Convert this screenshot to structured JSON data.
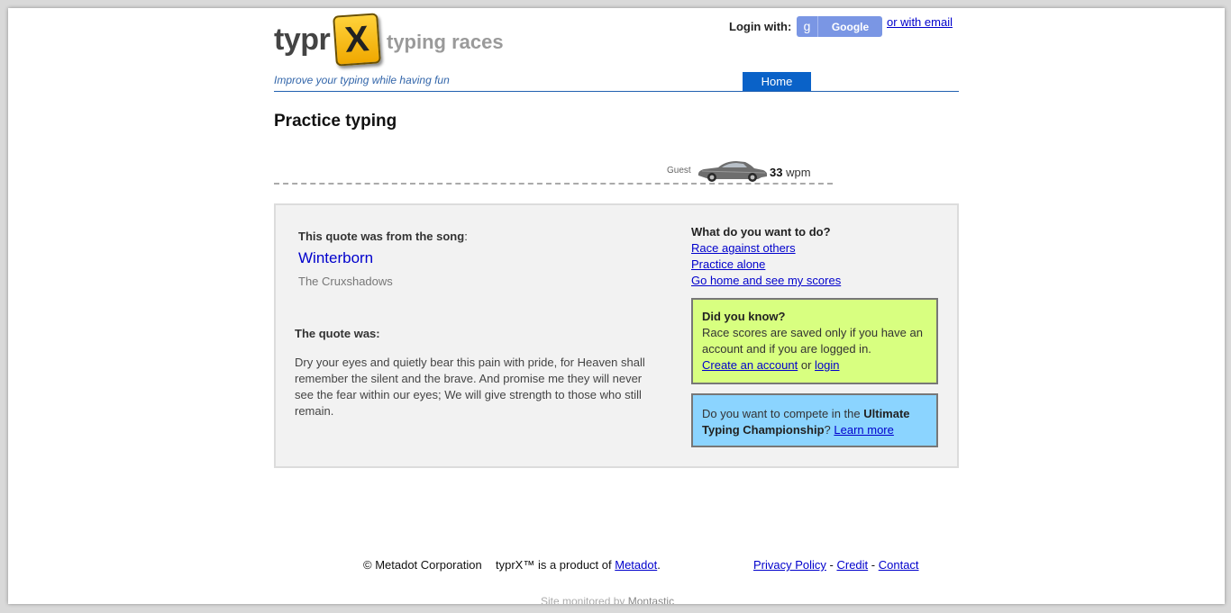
{
  "header": {
    "logo_word": "typr",
    "logo_letter": "X",
    "logo_tagline": "typing races",
    "slogan": "Improve your typing while having fun",
    "nav_home": "Home",
    "login_label": "Login with:",
    "google_icon": "g",
    "google_label": "Google",
    "email_link": "or with email"
  },
  "page": {
    "title": "Practice typing"
  },
  "race": {
    "player": "Guest",
    "wpm_value": "33",
    "wpm_unit": "wpm",
    "car_icon": "car-icon"
  },
  "quote": {
    "source_label": "This quote was from the song",
    "source_colon": ":",
    "song_title": "Winterborn",
    "artist": "The Cruxshadows",
    "quote_label": "The quote was:",
    "text": "Dry your eyes and quietly bear this pain with pride, for Heaven shall remember the silent and the brave. And promise me they will never see the fear within our eyes; We will give strength to those who still remain."
  },
  "todo": {
    "heading": "What do you want to do?",
    "links": [
      "Race against others",
      "Practice alone",
      "Go home and see my scores"
    ]
  },
  "did_you_know": {
    "heading": "Did you know?",
    "text": "Race scores are saved only if you have an account and if you are logged in.",
    "create_link": "Create an account",
    "or_text": "or",
    "login_link": "login"
  },
  "championship": {
    "text_before": "Do you want to compete in the",
    "bold_text": "Ultimate Typing Championship",
    "question_mark": "?",
    "learn_more": "Learn more"
  },
  "footer": {
    "copyright": "© Metadot Corporation",
    "product_text": "typrX™ is a product of",
    "metadot_link": "Metadot",
    "period": ".",
    "privacy": "Privacy Policy",
    "sep1": " - ",
    "credit": "Credit",
    "sep2": " - ",
    "contact": "Contact",
    "monitored_text": "Site monitored by",
    "monitored_brand": "Montastic"
  },
  "colors": {
    "accent_blue": "#0a62c8",
    "tip_green": "#d8ff80",
    "tip_blue": "#8bd4ff",
    "google_blue": "#7a96e4"
  }
}
